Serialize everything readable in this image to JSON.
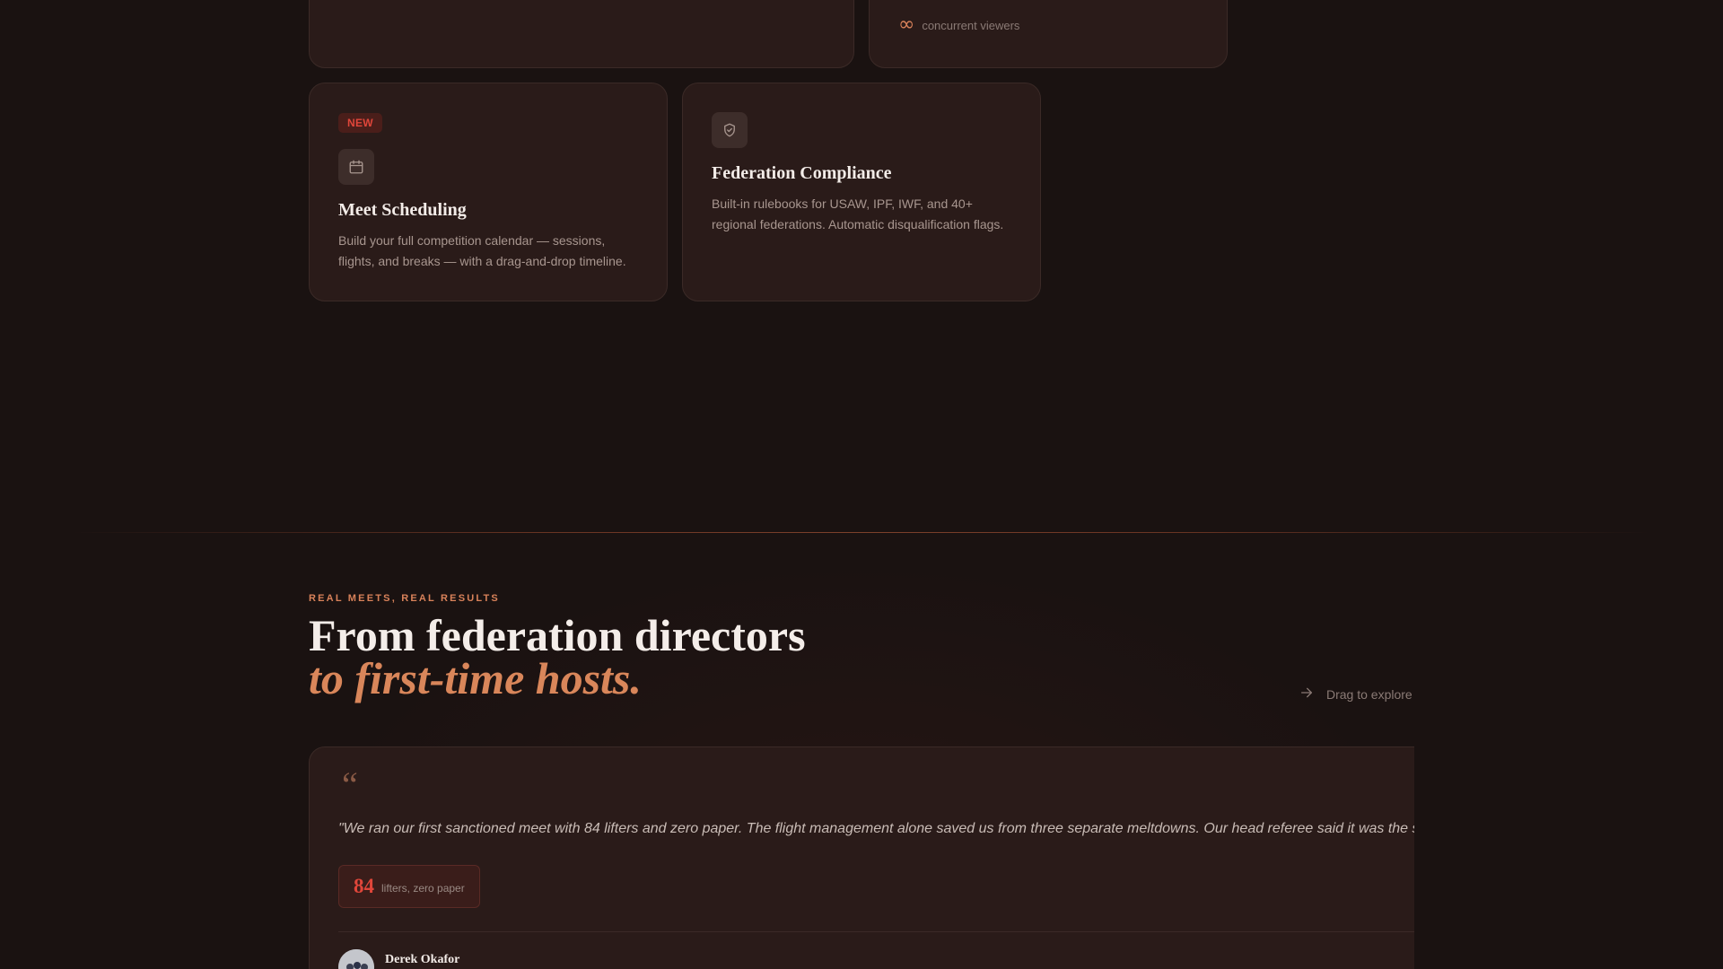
{
  "top_cards": {
    "viewers": {
      "icon": "infinity-icon",
      "symbol": "∞",
      "label": "concurrent viewers"
    }
  },
  "features": [
    {
      "badge": "NEW",
      "icon": "calendar-icon",
      "title": "Meet Scheduling",
      "description": "Build your full competition calendar — sessions, flights, and breaks — with a drag-and-drop timeline."
    },
    {
      "icon": "shield-check-icon",
      "title": "Federation Compliance",
      "description": "Built-in rulebooks for USAW, IPF, IWF, and 40+ regional federations. Automatic disqualification flags."
    }
  ],
  "testimonials_section": {
    "eyebrow": "REAL MEETS, REAL RESULTS",
    "headline_line1": "From federation directors",
    "headline_line2": "to first-time hosts.",
    "drag_hint": "Drag to explore",
    "drag_icon": "arrow-right-icon"
  },
  "testimonials": [
    {
      "quote_mark": "“",
      "quote": "\"We ran our first sanctioned meet with 84 lifters and zero paper. The flight management alone saved us from three separate meltdowns. Our head referee said it was the s",
      "stat_value": "84",
      "stat_label": "lifters, zero paper",
      "author": "Derek Okafor"
    }
  ],
  "colors": {
    "background": "#1a1211",
    "card": "#2a1b19",
    "accent": "#d9825a",
    "badge_red": "#e0463a"
  }
}
